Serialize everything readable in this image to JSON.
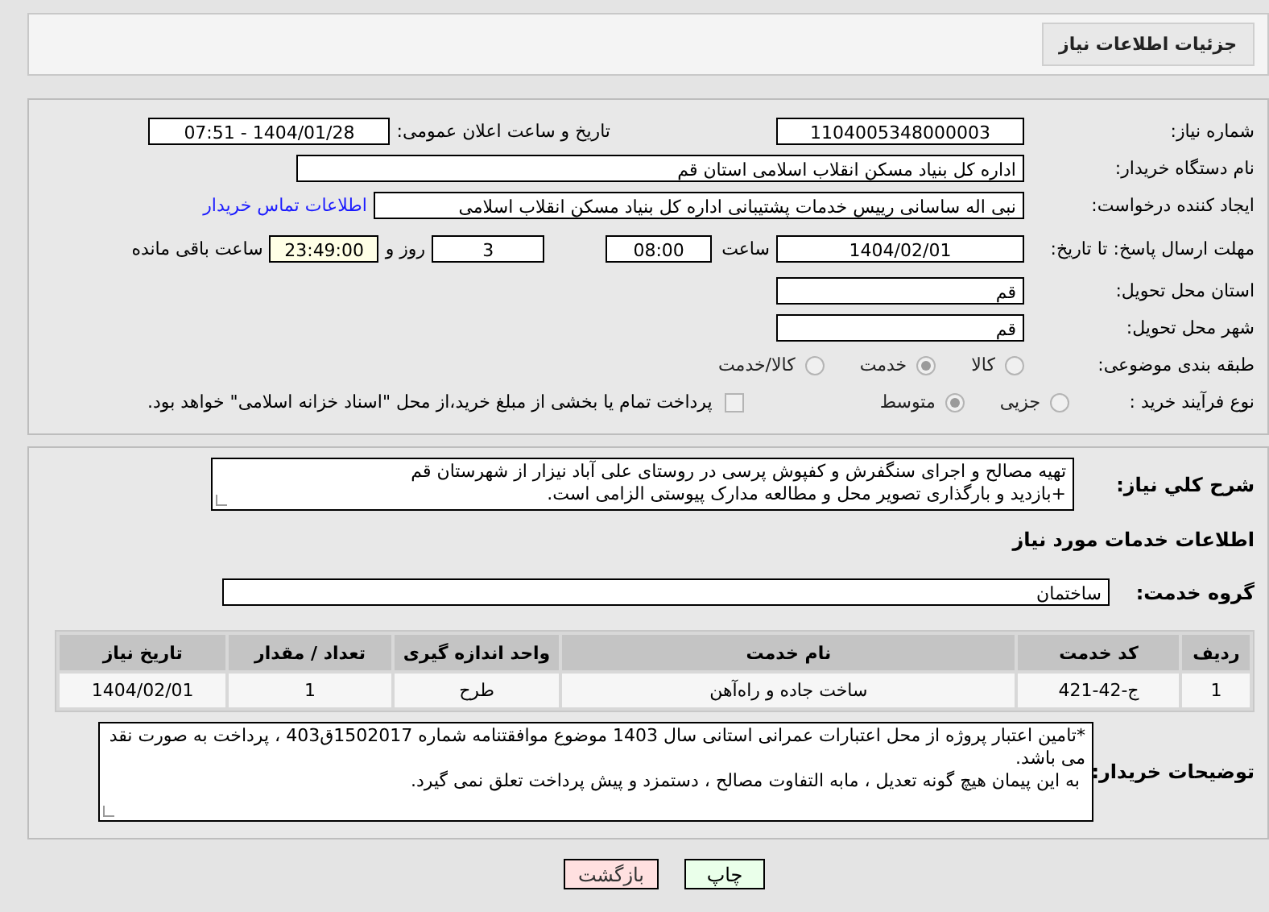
{
  "header": {
    "title": "جزئیات اطلاعات نیاز"
  },
  "need_info": {
    "need_number": {
      "label": "شماره نیاز:",
      "value": "1104005348000003"
    },
    "announce": {
      "label": "تاریخ و ساعت اعلان عمومی:",
      "value": "1404/01/28 - 07:51"
    },
    "buyer": {
      "label": "نام دستگاه خریدار:",
      "value": "اداره کل بنیاد مسکن انقلاب اسلامی استان قم"
    },
    "requester": {
      "label": "ایجاد کننده درخواست:",
      "value": "نبی اله ساسانی رییس خدمات پشتیبانی اداره کل بنیاد مسکن انقلاب اسلامی",
      "contact_link": "اطلاعات تماس خریدار"
    },
    "deadline": {
      "label": "مهلت ارسال پاسخ: تا تاریخ:",
      "date": "1404/02/01",
      "time_label": "ساعت",
      "time": "08:00",
      "days": "3",
      "days_label": "روز و",
      "remaining": "23:49:00",
      "remaining_label": "ساعت باقی مانده"
    },
    "province": {
      "label": "استان محل تحویل:",
      "value": "قم"
    },
    "city": {
      "label": "شهر محل تحویل:",
      "value": "قم"
    },
    "category": {
      "label": "طبقه بندی موضوعی:",
      "options": [
        {
          "label": "کالا",
          "selected": false
        },
        {
          "label": "خدمت",
          "selected": true
        },
        {
          "label": "کالا/خدمت",
          "selected": false
        }
      ]
    },
    "purchase": {
      "label": "نوع فرآیند خرید :",
      "options": [
        {
          "label": "جزیی",
          "selected": false
        },
        {
          "label": "متوسط",
          "selected": true
        }
      ],
      "payment_note": {
        "label": "پرداخت تمام یا بخشی از مبلغ خرید،از محل \"اسناد خزانه اسلامی\" خواهد بود.",
        "checked": false
      }
    }
  },
  "services": {
    "description": {
      "label": "شرح کلي نیاز:",
      "text": "تهیه مصالح و اجرای سنگفرش و کفپوش پرسی در روستای علی آباد نیزار از شهرستان قم\n+بازدید و بارگذاری تصویر محل و مطالعه مدارک پیوستی الزامی است."
    },
    "section_title": "اطلاعات خدمات مورد نیاز",
    "service_group": {
      "label": "گروه خدمت:",
      "value": "ساختمان"
    },
    "table": {
      "columns": [
        "ردیف",
        "کد خدمت",
        "نام خدمت",
        "واحد اندازه گیری",
        "تعداد / مقدار",
        "تاریخ نیاز"
      ],
      "rows": [
        [
          "1",
          "ج-42-421",
          "ساخت جاده و راه‌آهن",
          "طرح",
          "1",
          "1404/02/01"
        ]
      ]
    },
    "buyer_notes": {
      "label": "توضیحات خریدار:",
      "text": "*تامین اعتبار پروژه از محل اعتبارات عمرانی استانی سال 1403 موضوع موافقتنامه شماره 1502017ق403 ، پرداخت به صورت نقد می باشد.\n به این پیمان هیچ گونه تعدیل ، مابه التفاوت مصالح ، دستمزد و پیش پرداخت تعلق نمی گیرد."
    }
  },
  "buttons": [
    {
      "label": "چاپ",
      "kind": "print"
    },
    {
      "label": "بازگشت",
      "kind": "back"
    }
  ]
}
